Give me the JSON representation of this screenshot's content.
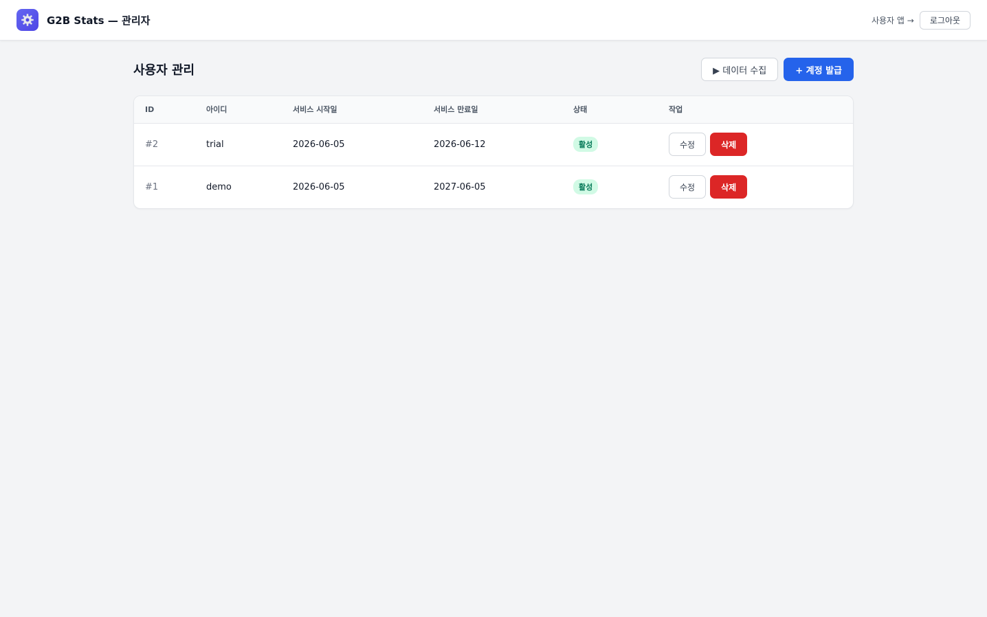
{
  "header": {
    "title": "G2B Stats — 관리자",
    "user_app_link": "사용자 앱 →",
    "logout_label": "로그아웃"
  },
  "page": {
    "title": "사용자 관리",
    "collect_label": "▶ 데이터 수집",
    "issue_label": "+ 계정 발급"
  },
  "table": {
    "columns": [
      "ID",
      "아이디",
      "서비스 시작일",
      "서비스 만료일",
      "상태",
      "작업"
    ],
    "rows": [
      {
        "id": "#2",
        "username": "trial",
        "start": "2026-06-05",
        "end": "2026-06-12",
        "status": "활성",
        "edit": "수정",
        "delete": "삭제"
      },
      {
        "id": "#1",
        "username": "demo",
        "start": "2026-06-05",
        "end": "2027-06-05",
        "status": "활성",
        "edit": "수정",
        "delete": "삭제"
      }
    ]
  },
  "colors": {
    "primary": "#2563eb",
    "danger": "#dc2626",
    "status_active_bg": "#d1fae5",
    "status_active_text": "#047857",
    "logo": "#4f46e5"
  },
  "icons": {
    "logo": "gear-icon"
  }
}
